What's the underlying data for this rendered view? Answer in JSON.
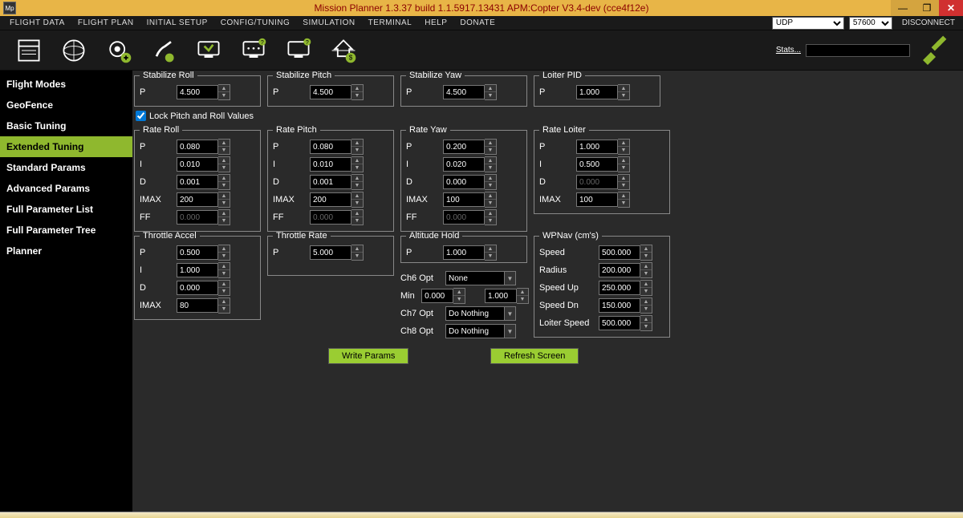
{
  "title": "Mission Planner 1.3.37 build 1.1.5917.13431 APM:Copter V3.4-dev (cce4f12e)",
  "titlebar_icon": "Mp",
  "topmenu": [
    "FLIGHT DATA",
    "FLIGHT PLAN",
    "INITIAL SETUP",
    "CONFIG/TUNING",
    "SIMULATION",
    "TERMINAL",
    "HELP",
    "DONATE"
  ],
  "conn": {
    "proto": "UDP",
    "baud": "57600",
    "disconnect": "DISCONNECT",
    "stats": "Stats..."
  },
  "sidebar": {
    "items": [
      "Flight Modes",
      "GeoFence",
      "Basic Tuning",
      "Extended Tuning",
      "Standard Params",
      "Advanced Params",
      "Full Parameter List",
      "Full Parameter Tree",
      "Planner"
    ],
    "active": 3
  },
  "lock_label": "Lock Pitch and Roll Values",
  "lock_checked": true,
  "groups": {
    "stab_roll": {
      "title": "Stabilize Roll",
      "P": "4.500"
    },
    "stab_pitch": {
      "title": "Stabilize Pitch",
      "P": "4.500"
    },
    "stab_yaw": {
      "title": "Stabilize Yaw",
      "P": "4.500"
    },
    "loiter_pid": {
      "title": "Loiter PID",
      "P": "1.000"
    },
    "rate_roll": {
      "title": "Rate Roll",
      "P": "0.080",
      "I": "0.010",
      "D": "0.001",
      "IMAX": "200",
      "FF": "0.000"
    },
    "rate_pitch": {
      "title": "Rate Pitch",
      "P": "0.080",
      "I": "0.010",
      "D": "0.001",
      "IMAX": "200",
      "FF": "0.000"
    },
    "rate_yaw": {
      "title": "Rate Yaw",
      "P": "0.200",
      "I": "0.020",
      "D": "0.000",
      "IMAX": "100",
      "FF": "0.000"
    },
    "rate_loiter": {
      "title": "Rate Loiter",
      "P": "1.000",
      "I": "0.500",
      "D": "0.000",
      "IMAX": "100"
    },
    "thr_accel": {
      "title": "Throttle Accel",
      "P": "0.500",
      "I": "1.000",
      "D": "0.000",
      "IMAX": "80"
    },
    "thr_rate": {
      "title": "Throttle Rate",
      "P": "5.000"
    },
    "alt_hold": {
      "title": "Altitude Hold",
      "P": "1.000"
    },
    "wpnav": {
      "title": "WPNav (cm's)",
      "Speed": "500.000",
      "Radius": "200.000",
      "Speed Up": "250.000",
      "Speed Dn": "150.000",
      "Loiter Speed": "500.000"
    }
  },
  "ch": {
    "ch6_label": "Ch6 Opt",
    "ch6": "None",
    "min_label": "Min",
    "min": "0.000",
    "max": "1.000",
    "ch7_label": "Ch7 Opt",
    "ch7": "Do Nothing",
    "ch8_label": "Ch8 Opt",
    "ch8": "Do Nothing"
  },
  "buttons": {
    "write": "Write Params",
    "refresh": "Refresh Screen"
  },
  "labels": {
    "P": "P",
    "I": "I",
    "D": "D",
    "IMAX": "IMAX",
    "FF": "FF",
    "Speed": "Speed",
    "Radius": "Radius",
    "SpeedUp": "Speed Up",
    "SpeedDn": "Speed Dn",
    "LoiterSpeed": "Loiter Speed"
  }
}
